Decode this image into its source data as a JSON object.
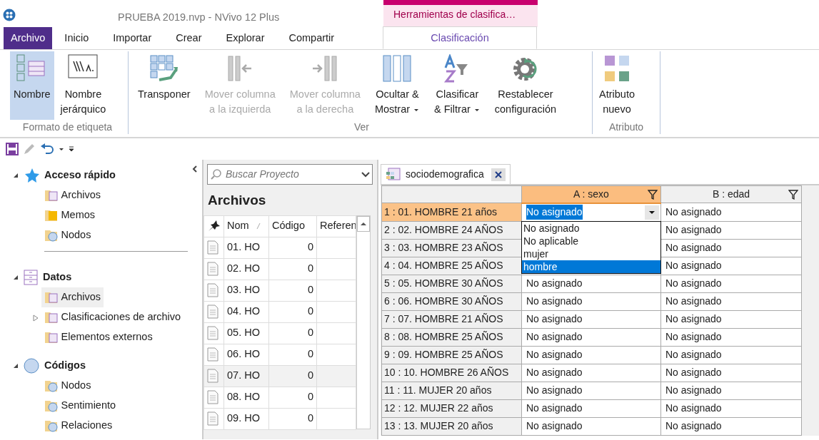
{
  "window": {
    "title": "PRUEBA 2019.nvp - NVivo 12 Plus"
  },
  "contextual_tab": {
    "label": "Herramientas de clasifica…"
  },
  "ribbon_tabs": [
    {
      "label": "Archivo",
      "kind": "file",
      "selected": false
    },
    {
      "label": "Inicio",
      "kind": "tab",
      "selected": false
    },
    {
      "label": "Importar",
      "kind": "tab",
      "selected": false
    },
    {
      "label": "Crear",
      "kind": "tab",
      "selected": false
    },
    {
      "label": "Explorar",
      "kind": "tab",
      "selected": false
    },
    {
      "label": "Compartir",
      "kind": "tab",
      "selected": false
    },
    {
      "label": "Clasificación",
      "kind": "context",
      "selected": true
    }
  ],
  "ribbon_groups": [
    {
      "label": "Formato de etiqueta",
      "buttons": [
        {
          "lines": [
            "Nombre"
          ],
          "selected": true,
          "disabled": false
        },
        {
          "lines": [
            "Nombre",
            "jerárquico"
          ],
          "selected": false,
          "disabled": false
        }
      ]
    },
    {
      "label": "Ver",
      "buttons": [
        {
          "lines": [
            "Transponer"
          ],
          "selected": false,
          "disabled": false
        },
        {
          "lines": [
            "Mover columna",
            "a la izquierda"
          ],
          "selected": false,
          "disabled": true
        },
        {
          "lines": [
            "Mover columna",
            "a la derecha"
          ],
          "selected": false,
          "disabled": true
        },
        {
          "lines": [
            "Ocultar &",
            "Mostrar"
          ],
          "selected": false,
          "disabled": false,
          "dropdown": true
        },
        {
          "lines": [
            "Clasificar",
            "& Filtrar"
          ],
          "selected": false,
          "disabled": false,
          "dropdown": true
        },
        {
          "lines": [
            "Restablecer",
            "configuración"
          ],
          "selected": false,
          "disabled": false
        }
      ]
    },
    {
      "label": "Atributo",
      "buttons": [
        {
          "lines": [
            "Atributo",
            "nuevo"
          ],
          "selected": false,
          "disabled": false
        }
      ]
    }
  ],
  "navigation": {
    "sections": [
      {
        "label": "Acceso rápido",
        "expanded": true,
        "children": [
          {
            "label": "Archivos",
            "selected": false
          },
          {
            "label": "Memos",
            "selected": false
          },
          {
            "label": "Nodos",
            "selected": false
          }
        ]
      },
      {
        "label": "Datos",
        "expanded": true,
        "children": [
          {
            "label": "Archivos",
            "selected": true
          },
          {
            "label": "Clasificaciones de archivo",
            "selected": false,
            "expanded": false
          },
          {
            "label": "Elementos externos",
            "selected": false
          }
        ]
      },
      {
        "label": "Códigos",
        "expanded": true,
        "children": [
          {
            "label": "Nodos",
            "selected": false
          },
          {
            "label": "Sentimiento",
            "selected": false
          },
          {
            "label": "Relaciones",
            "selected": false
          }
        ]
      }
    ]
  },
  "file_list": {
    "search": {
      "placeholder": "Buscar Proyecto"
    },
    "title": "Archivos",
    "columns": [
      "Nom",
      "Código",
      "Referen"
    ],
    "rows": [
      {
        "name": "01. HO",
        "codes": "0",
        "selected": false
      },
      {
        "name": "02. HO",
        "codes": "0",
        "selected": false
      },
      {
        "name": "03. HO",
        "codes": "0",
        "selected": false
      },
      {
        "name": "04. HO",
        "codes": "0",
        "selected": false
      },
      {
        "name": "05. HO",
        "codes": "0",
        "selected": false
      },
      {
        "name": "06. HO",
        "codes": "0",
        "selected": false
      },
      {
        "name": "07. HO",
        "codes": "0",
        "selected": true
      },
      {
        "name": "08. HO",
        "codes": "0",
        "selected": false
      },
      {
        "name": "09. HO",
        "codes": "0",
        "selected": false
      }
    ]
  },
  "document_tab": {
    "label": "sociodemografica"
  },
  "classification_sheet": {
    "columns": [
      {
        "label": "A : sexo",
        "selected": true
      },
      {
        "label": "B : edad",
        "selected": false
      }
    ],
    "rows": [
      {
        "label": "1 : 01. HOMBRE 21 años",
        "selected": true,
        "a": "No asignado",
        "b": "No asignado"
      },
      {
        "label": "2 : 02. HOMBRE 24 AÑOS",
        "selected": false,
        "b": "No asignado"
      },
      {
        "label": "3 : 03. HOMBRE 23 AÑOS",
        "selected": false,
        "b": "No asignado"
      },
      {
        "label": "4 : 04. HOMBRE 25 AÑOS",
        "selected": false,
        "b": "No asignado"
      },
      {
        "label": "5 : 05. HOMBRE 30 AÑOS",
        "selected": false,
        "a": "No asignado",
        "b": "No asignado"
      },
      {
        "label": "6 : 06. HOMBRE 30 AÑOS",
        "selected": false,
        "a": "No asignado",
        "b": "No asignado"
      },
      {
        "label": "7 : 07. HOMBRE 21 AÑOS",
        "selected": false,
        "a": "No asignado",
        "b": "No asignado"
      },
      {
        "label": "8 : 08. HOMBRE 25 AÑOS",
        "selected": false,
        "a": "No asignado",
        "b": "No asignado"
      },
      {
        "label": "9 : 09. HOMBRE 25 AÑOS",
        "selected": false,
        "a": "No asignado",
        "b": "No asignado"
      },
      {
        "label": "10 : 10. HOMBRE 26 AÑOS",
        "selected": false,
        "a": "No asignado",
        "b": "No asignado"
      },
      {
        "label": "11 : 11. MUJER 20 años",
        "selected": false,
        "a": "No asignado",
        "b": "No asignado"
      },
      {
        "label": "12 : 12. MUJER 22 años",
        "selected": false,
        "a": "No asignado",
        "b": "No asignado"
      },
      {
        "label": "13 : 13. MUJER 20 años",
        "selected": false,
        "a": "No asignado",
        "b": "No asignado"
      }
    ],
    "dropdown": {
      "options": [
        {
          "label": "No asignado",
          "selected": false
        },
        {
          "label": "No aplicable",
          "selected": false
        },
        {
          "label": "mujer",
          "selected": false
        },
        {
          "label": "hombre",
          "selected": true
        }
      ]
    }
  }
}
